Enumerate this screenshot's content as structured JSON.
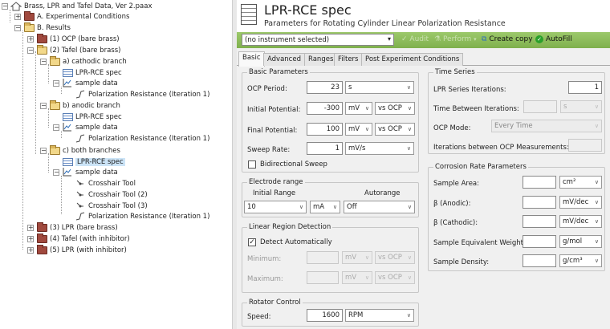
{
  "tree": {
    "root": "Brass, LPR and Tafel Data, Ver 2.paax",
    "a_experimental": "A. Experimental Conditions",
    "b_results": "B. Results",
    "ocp": "(1) OCP (bare brass)",
    "tafel": "(2) Tafel (bare brass)",
    "cathodic": "a) cathodic branch",
    "anodic": "b) anodic branch",
    "both": "c) both branches",
    "spec": "LPR-RCE spec",
    "sample_data": "sample data",
    "pol_res": "Polarization Resistance (Iteration 1)",
    "cross1": "Crosshair Tool",
    "cross2": "Crosshair Tool (2)",
    "cross3": "Crosshair Tool (3)",
    "lpr": "(3) LPR (bare brass)",
    "tafel_inh": "(4) Tafel (with inhibitor)",
    "lpr_inh": "(5) LPR (with inhibitor)"
  },
  "header": {
    "title": "LPR-RCE spec",
    "subtitle": "Parameters for Rotating Cylinder Linear Polarization Resistance"
  },
  "toolbar": {
    "instrument": "(no instrument selected)",
    "audit": "Audit",
    "perform": "Perform",
    "create_copy": "Create copy",
    "autofill": "AutoFill"
  },
  "tabs": [
    "Basic",
    "Advanced",
    "Ranges",
    "Filters",
    "Post Experiment Conditions"
  ],
  "basic": {
    "title": "Basic Parameters",
    "ocp_period_label": "OCP Period:",
    "ocp_period_value": "23",
    "ocp_period_unit": "s",
    "initial_label": "Initial Potential:",
    "initial_value": "-300",
    "initial_unit": "mV",
    "initial_ref": "vs OCP",
    "final_label": "Final Potential:",
    "final_value": "100",
    "final_unit": "mV",
    "final_ref": "vs OCP",
    "sweep_label": "Sweep Rate:",
    "sweep_value": "1",
    "sweep_unit": "mV/s",
    "bidirectional": "Bidirectional Sweep"
  },
  "electrode": {
    "title": "Electrode range",
    "initial_range": "Initial Range",
    "autorange": "Autorange",
    "range_value": "10",
    "range_unit": "mA",
    "auto_value": "Off"
  },
  "linear": {
    "title": "Linear Region Detection",
    "detect": "Detect Automatically",
    "min_label": "Minimum:",
    "max_label": "Maximum:",
    "unit": "mV",
    "ref": "vs OCP"
  },
  "rotator": {
    "title": "Rotator Control",
    "speed_label": "Speed:",
    "speed_value": "1600",
    "speed_unit": "RPM"
  },
  "time_series": {
    "title": "Time Series",
    "iterations_label": "LPR Series Iterations:",
    "iterations_value": "1",
    "between_label": "Time Between Iterations:",
    "between_unit": "s",
    "ocp_mode_label": "OCP Mode:",
    "ocp_mode_value": "Every Time",
    "iter_ocp_label": "Iterations between OCP Measurements:"
  },
  "corrosion": {
    "title": "Corrosion Rate Parameters",
    "area_label": "Sample Area:",
    "area_unit": "cm²",
    "anodic_label": "β (Anodic):",
    "anodic_unit": "mV/dec",
    "cathodic_label": "β (Cathodic):",
    "cathodic_unit": "mV/dec",
    "weight_label": "Sample Equivalent Weight:",
    "weight_unit": "g/mol",
    "density_label": "Sample Density:",
    "density_unit": "g/cm³"
  }
}
